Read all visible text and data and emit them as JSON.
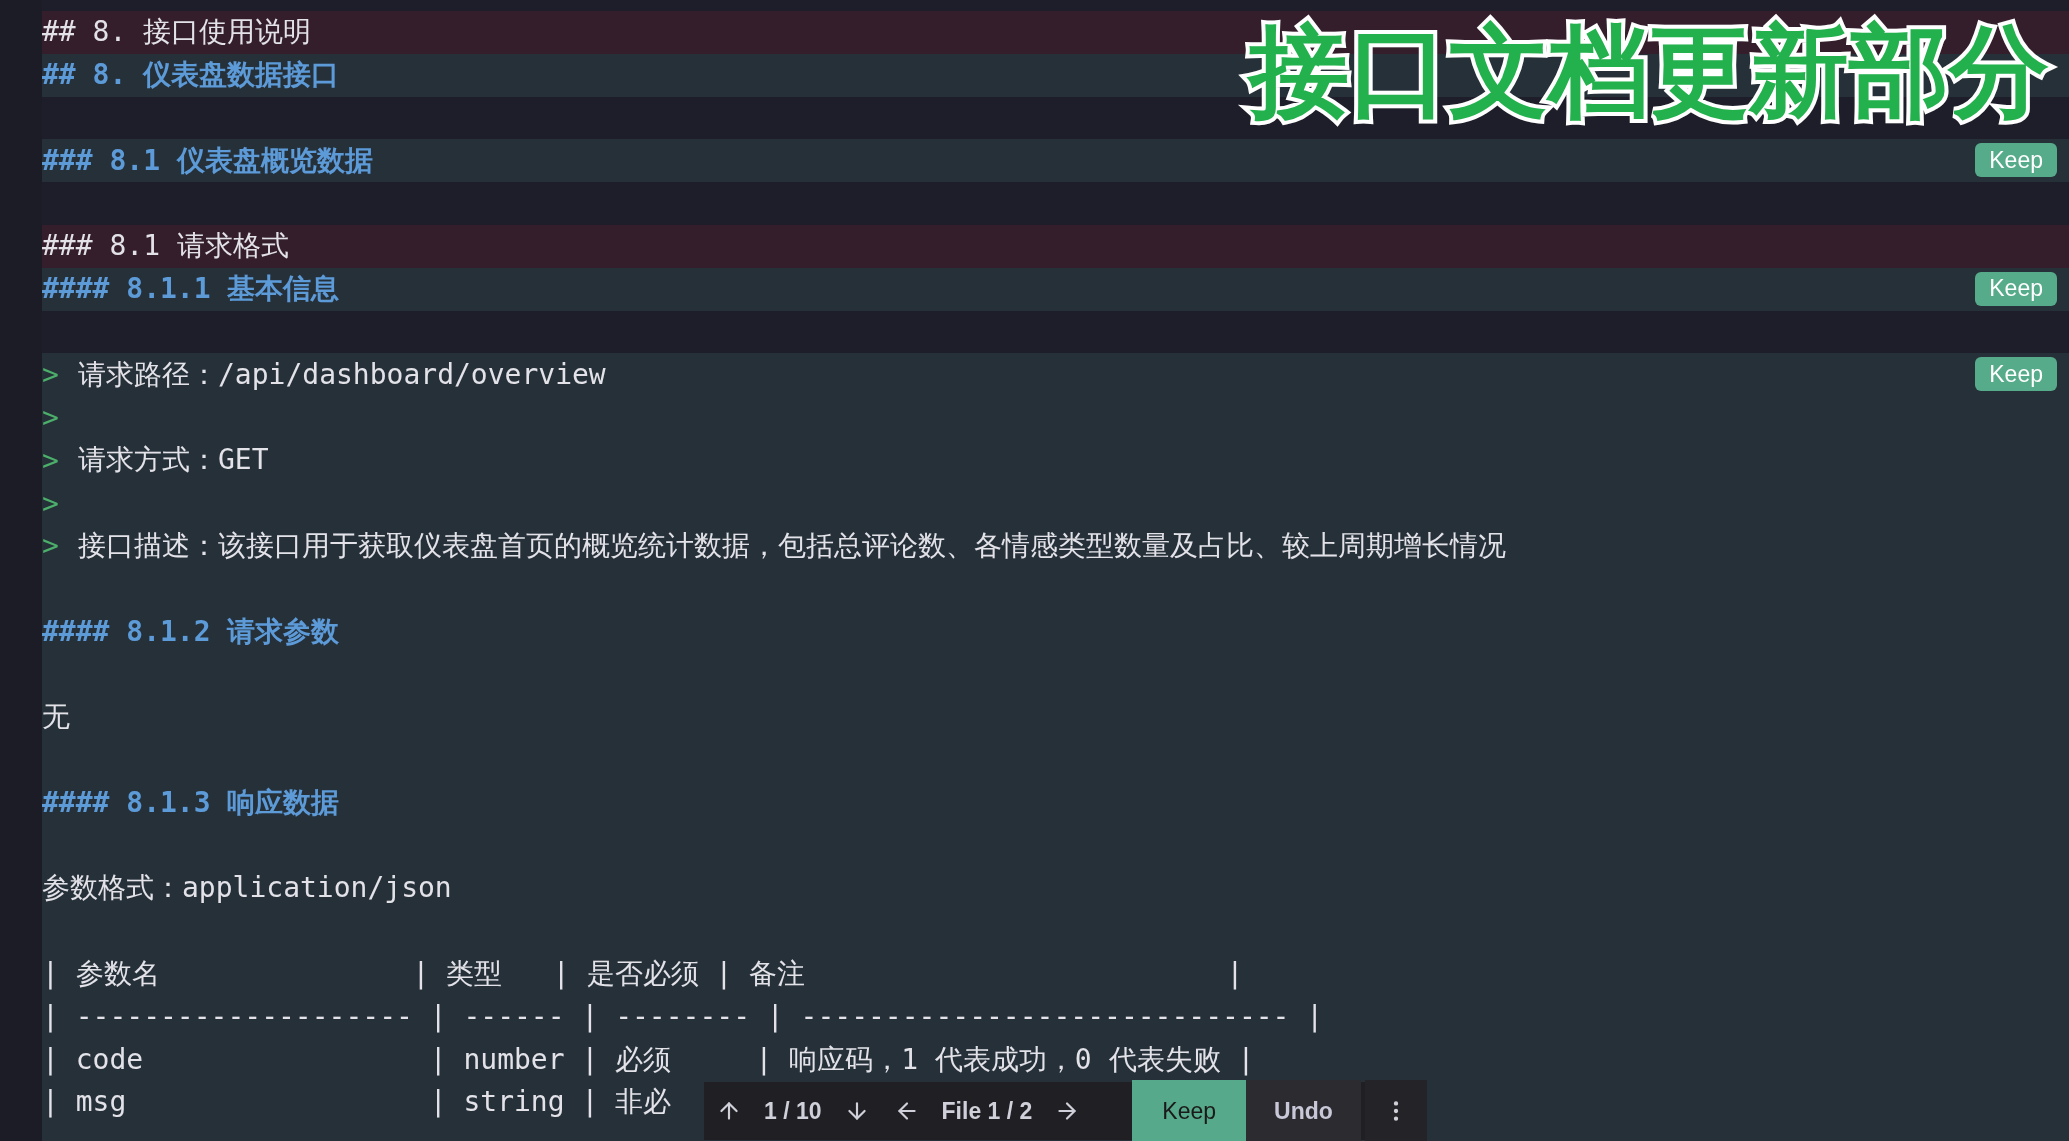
{
  "caption": "接口文档更新部分",
  "lines": [
    {
      "kind": "removed",
      "text": "## 8. 接口使用说明"
    },
    {
      "kind": "heading",
      "text": "## 8. 仪表盘数据接口"
    },
    {
      "kind": "gap"
    },
    {
      "kind": "heading",
      "text": "### 8.1 仪表盘概览数据",
      "keep": "Keep"
    },
    {
      "kind": "gap"
    },
    {
      "kind": "removed",
      "text": "### 8.1 请求格式"
    },
    {
      "kind": "heading",
      "text": "#### 8.1.1 基本信息",
      "keep": "Keep"
    },
    {
      "kind": "gap"
    },
    {
      "kind": "quote",
      "marker": ">",
      "text": "请求路径：/api/dashboard/overview",
      "keep": "Keep"
    },
    {
      "kind": "quote",
      "marker": ">"
    },
    {
      "kind": "quote",
      "marker": ">",
      "text": "请求方式：GET"
    },
    {
      "kind": "quote",
      "marker": ">"
    },
    {
      "kind": "quote",
      "marker": ">",
      "text": "接口描述：该接口用于获取仪表盘首页的概览统计数据，包括总评论数、各情感类型数量及占比、较上周期增长情况"
    },
    {
      "kind": "blank"
    },
    {
      "kind": "heading",
      "text": "#### 8.1.2 请求参数"
    },
    {
      "kind": "blank"
    },
    {
      "kind": "text",
      "text": "无"
    },
    {
      "kind": "blank"
    },
    {
      "kind": "heading",
      "text": "#### 8.1.3 响应数据"
    },
    {
      "kind": "blank"
    },
    {
      "kind": "text",
      "text": "参数格式：application/json"
    },
    {
      "kind": "blank"
    },
    {
      "kind": "text",
      "text": "| 参数名               | 类型   | 是否必须 | 备注                         |"
    },
    {
      "kind": "text",
      "text": "| -------------------- | ------ | -------- | ----------------------------- |"
    },
    {
      "kind": "text",
      "text": "| code                 | number | 必须     | 响应码，1 代表成功，0 代表失败 |"
    },
    {
      "kind": "text",
      "text": "| msg                  | string | 非必"
    },
    {
      "kind": "blank"
    }
  ],
  "toolbar": {
    "change_counter": "1 / 10",
    "file_counter": "File 1 / 2",
    "keep": "Keep",
    "undo": "Undo"
  }
}
